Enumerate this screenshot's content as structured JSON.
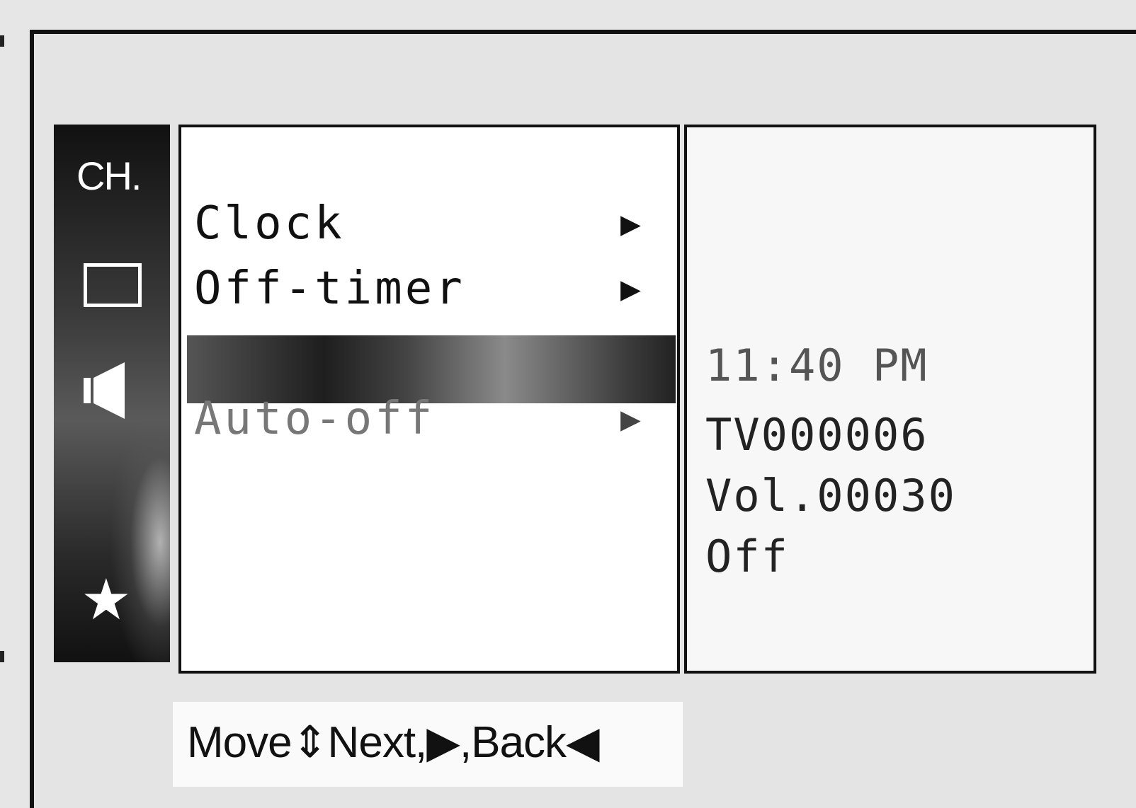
{
  "sidebar": {
    "items": [
      {
        "label": "CH.",
        "icon": "channel-label"
      },
      {
        "icon": "screen-icon"
      },
      {
        "icon": "speaker-icon"
      },
      {
        "icon": "star-icon",
        "glyph": "★"
      }
    ]
  },
  "menu": {
    "items": [
      {
        "label": "Clock",
        "arrow": "▶"
      },
      {
        "label": "Off-timer",
        "arrow": "▶"
      },
      {
        "label": "",
        "highlighted": true
      },
      {
        "label": "Auto-off",
        "arrow": "▶"
      }
    ]
  },
  "info": {
    "time": "11:40 PM",
    "lines": [
      "TV000006",
      "Vol.00030",
      "Off"
    ]
  },
  "hint": {
    "text": "Move⇕Next,▶,Back◀"
  },
  "colors": {
    "background": "#e6e6e6",
    "sidebar": "#1a1a1a",
    "panel": "#ffffff",
    "text": "#111111",
    "dim_text": "#777777"
  }
}
